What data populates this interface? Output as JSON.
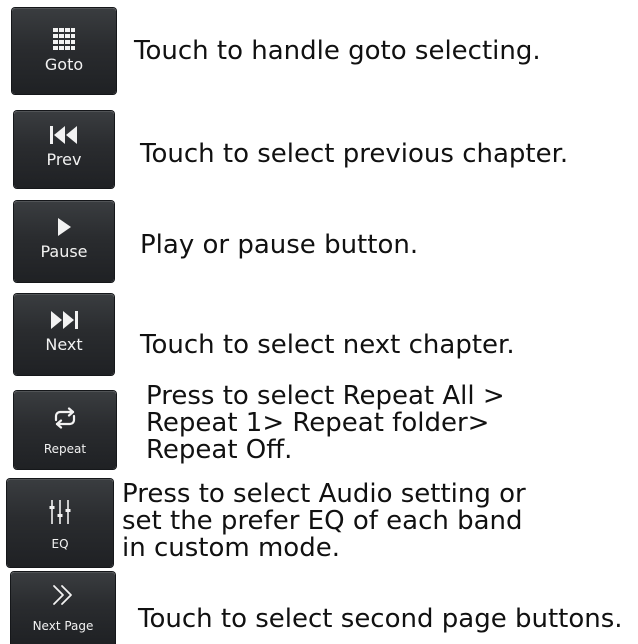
{
  "items": [
    {
      "button_label": "Goto",
      "icon": "grid-icon",
      "description": [
        "Touch to handle goto selecting."
      ]
    },
    {
      "button_label": "Prev",
      "icon": "skip-previous-icon",
      "description": [
        "Touch to select previous chapter."
      ]
    },
    {
      "button_label": "Pause",
      "icon": "play-icon",
      "description": [
        "Play or pause button."
      ]
    },
    {
      "button_label": "Next",
      "icon": "skip-next-icon",
      "description": [
        "Touch to select next chapter."
      ]
    },
    {
      "button_label": "Repeat",
      "icon": "repeat-icon",
      "description": [
        "Press to select Repeat All >",
        "Repeat 1> Repeat folder>",
        "Repeat Off."
      ]
    },
    {
      "button_label": "EQ",
      "icon": "equalizer-icon",
      "description": [
        "Press to select Audio setting or",
        "set the prefer EQ of each band",
        "in custom mode."
      ]
    },
    {
      "button_label": "Next Page",
      "icon": "double-chevron-right-icon",
      "description": [
        "Touch to select second page buttons."
      ]
    }
  ],
  "colors": {
    "button_bg": "#2a2c2f",
    "button_text": "#f2f2f2",
    "text": "#111111"
  }
}
